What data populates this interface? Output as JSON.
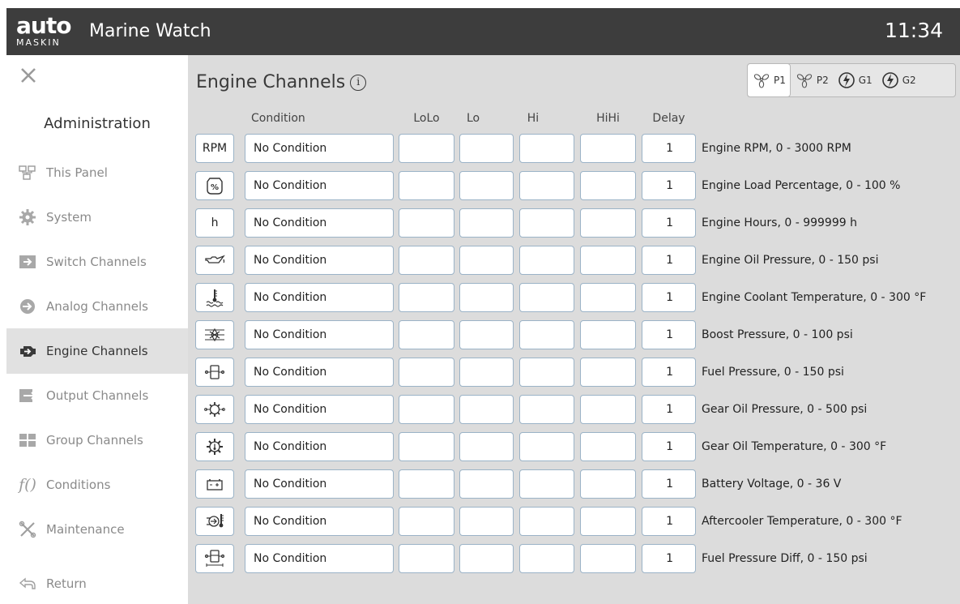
{
  "header": {
    "logo_main": "auto",
    "logo_sub": "MASKIN",
    "app_title": "Marine Watch",
    "time": "11:34"
  },
  "sidebar": {
    "section_title": "Administration",
    "items": [
      {
        "label": "This Panel",
        "icon": "panel-icon",
        "active": false
      },
      {
        "label": "System",
        "icon": "gear-icon",
        "active": false
      },
      {
        "label": "Switch Channels",
        "icon": "switch-icon",
        "active": false
      },
      {
        "label": "Analog Channels",
        "icon": "analog-icon",
        "active": false
      },
      {
        "label": "Engine Channels",
        "icon": "engine-icon",
        "active": true
      },
      {
        "label": "Output Channels",
        "icon": "output-icon",
        "active": false
      },
      {
        "label": "Group Channels",
        "icon": "group-icon",
        "active": false
      },
      {
        "label": "Conditions",
        "icon": "function-icon",
        "active": false
      },
      {
        "label": "Maintenance",
        "icon": "tools-icon",
        "active": false
      },
      {
        "label": "Return",
        "icon": "return-icon",
        "active": false
      }
    ]
  },
  "main": {
    "title": "Engine Channels",
    "engine_tabs": [
      {
        "label": "P1",
        "icon": "propeller-icon",
        "active": true
      },
      {
        "label": "P2",
        "icon": "propeller-icon",
        "active": false
      },
      {
        "label": "G1",
        "icon": "generator-icon",
        "active": false
      },
      {
        "label": "G2",
        "icon": "generator-icon",
        "active": false
      }
    ],
    "columns": {
      "condition": "Condition",
      "lolo": "LoLo",
      "lo": "Lo",
      "hi": "Hi",
      "hihi": "HiHi",
      "delay": "Delay"
    },
    "rows": [
      {
        "icon": "rpm",
        "icon_text": "RPM",
        "condition": "No Condition",
        "lolo": "",
        "lo": "",
        "hi": "",
        "hihi": "",
        "delay": "1",
        "description": "Engine RPM, 0 - 3000 RPM"
      },
      {
        "icon": "load-percent-icon",
        "icon_text": "%",
        "condition": "No Condition",
        "lolo": "",
        "lo": "",
        "hi": "",
        "hihi": "",
        "delay": "1",
        "description": "Engine Load Percentage, 0 - 100 %"
      },
      {
        "icon": "hours",
        "icon_text": "h",
        "condition": "No Condition",
        "lolo": "",
        "lo": "",
        "hi": "",
        "hihi": "",
        "delay": "1",
        "description": "Engine Hours, 0 - 999999 h"
      },
      {
        "icon": "oil-can-icon",
        "icon_text": "",
        "condition": "No Condition",
        "lolo": "",
        "lo": "",
        "hi": "",
        "hihi": "",
        "delay": "1",
        "description": "Engine Oil Pressure, 0 - 150 psi"
      },
      {
        "icon": "coolant-temp-icon",
        "icon_text": "",
        "condition": "No Condition",
        "lolo": "",
        "lo": "",
        "hi": "",
        "hihi": "",
        "delay": "1",
        "description": "Engine Coolant Temperature, 0 - 300 °F"
      },
      {
        "icon": "turbo-icon",
        "icon_text": "",
        "condition": "No Condition",
        "lolo": "",
        "lo": "",
        "hi": "",
        "hihi": "",
        "delay": "1",
        "description": "Boost Pressure, 0 - 100 psi"
      },
      {
        "icon": "fuel-icon",
        "icon_text": "",
        "condition": "No Condition",
        "lolo": "",
        "lo": "",
        "hi": "",
        "hihi": "",
        "delay": "1",
        "description": "Fuel Pressure, 0 - 150 psi"
      },
      {
        "icon": "gear-oil-pressure-icon",
        "icon_text": "",
        "condition": "No Condition",
        "lolo": "",
        "lo": "",
        "hi": "",
        "hihi": "",
        "delay": "1",
        "description": "Gear Oil Pressure, 0 - 500 psi"
      },
      {
        "icon": "gear-oil-temp-icon",
        "icon_text": "",
        "condition": "No Condition",
        "lolo": "",
        "lo": "",
        "hi": "",
        "hihi": "",
        "delay": "1",
        "description": "Gear Oil Temperature, 0 - 300 °F"
      },
      {
        "icon": "battery-icon",
        "icon_text": "",
        "condition": "No Condition",
        "lolo": "",
        "lo": "",
        "hi": "",
        "hihi": "",
        "delay": "1",
        "description": "Battery Voltage, 0 - 36 V"
      },
      {
        "icon": "aftercooler-icon",
        "icon_text": "",
        "condition": "No Condition",
        "lolo": "",
        "lo": "",
        "hi": "",
        "hihi": "",
        "delay": "1",
        "description": "Aftercooler Temperature, 0 - 300 °F"
      },
      {
        "icon": "fuel-diff-icon",
        "icon_text": "",
        "condition": "No Condition",
        "lolo": "",
        "lo": "",
        "hi": "",
        "hihi": "",
        "delay": "1",
        "description": "Fuel Pressure Diff, 0 - 150 psi"
      }
    ]
  },
  "colors": {
    "header_bg": "#3d3d3d",
    "main_bg": "#dcdcdc",
    "active_nav_bg": "#e1e1e1",
    "cell_border": "#9bb3c7"
  }
}
